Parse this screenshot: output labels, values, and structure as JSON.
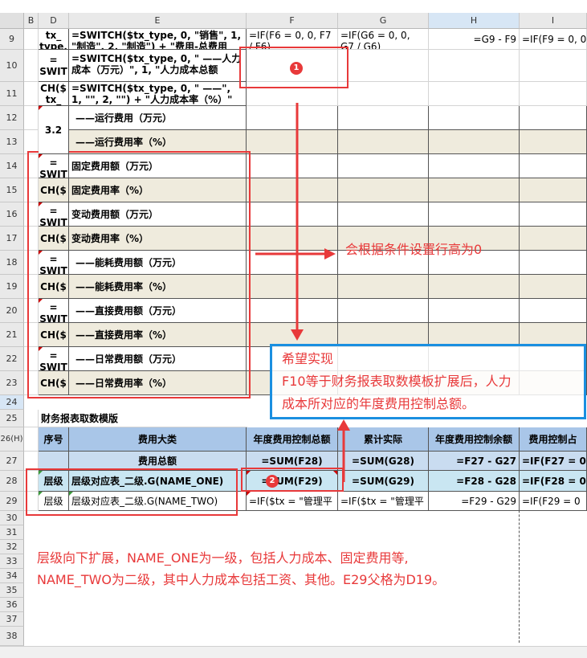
{
  "columns": [
    "B",
    "D",
    "E",
    "F",
    "G",
    "H",
    "I"
  ],
  "rows": {
    "r9": {
      "num": "9",
      "D": "tx_\ntype,",
      "E": "=SWITCH($tx_type, 0, \"销售\", 1, \"制造\", 2, \"制造\") + \"费用-总费用",
      "F": "=IF(F6 = 0, 0, F7 / F6)",
      "G": "=IF(G6 = 0, 0, G7 / G6)",
      "H": "=G9 - F9",
      "I": "=IF(F9 = 0, 0"
    },
    "r10": {
      "num": "10",
      "D": "=\nSWIT",
      "E": "=SWITCH($tx_type, 0, \" ——人力成本（万元）\", 1, \"人力成本总额"
    },
    "r11": {
      "num": "11",
      "D": "CH($\ntx_",
      "E": "=SWITCH($tx_type, 0, \" ——\", 1, \"\", 2, \"\") + \"人力成本率（%）\""
    },
    "r12": {
      "num": "12",
      "D": "3.2",
      "E": "——运行费用（万元）"
    },
    "r13": {
      "num": "13",
      "E": "——运行费用率（%）"
    },
    "r14": {
      "num": "14",
      "D": "=\nSWIT",
      "E": "固定费用额（万元）"
    },
    "r15": {
      "num": "15",
      "D": "CH($",
      "E": "固定费用率（%）"
    },
    "r16": {
      "num": "16",
      "D": "=\nSWIT",
      "E": "变动费用额（万元）"
    },
    "r17": {
      "num": "17",
      "D": "CH($",
      "E": "变动费用率（%）"
    },
    "r18": {
      "num": "18",
      "D": "=\nSWIT",
      "E": "——能耗费用额（万元）"
    },
    "r19": {
      "num": "19",
      "D": "CH($",
      "E": "——能耗费用率（%）"
    },
    "r20": {
      "num": "20",
      "D": "=\nSWIT",
      "E": "——直接费用额（万元）"
    },
    "r21": {
      "num": "21",
      "D": "CH($",
      "E": "——直接费用率（%）"
    },
    "r22": {
      "num": "22",
      "D": "=\nSWIT",
      "E": "——日常费用额（万元）"
    },
    "r23": {
      "num": "23",
      "D": "CH($",
      "E": "——日常费用率（%）"
    },
    "r24": {
      "num": "24"
    },
    "r25": {
      "num": "25",
      "D": "财务报表取数模版"
    },
    "r26": {
      "num": "26(H)",
      "D": "序号",
      "E": "费用大类",
      "F": "年度费用控制总额",
      "G": "累计实际",
      "H": "年度费用控制余额",
      "I": "费用控制占"
    },
    "r27": {
      "num": "27",
      "E": "费用总额",
      "F": "=SUM(F28)",
      "G": "=SUM(G28)",
      "H": "=F27 - G27",
      "I": "=IF(F27 = 0"
    },
    "r28": {
      "num": "28",
      "D": "层级",
      "E": "层级对应表_二级.G(NAME_ONE)",
      "F": "=SUM(F29)",
      "G": "=SUM(G29)",
      "H": "=F28 - G28",
      "I": "=IF(F28 = 0"
    },
    "r29": {
      "num": "29",
      "D": "层级",
      "E": "层级对应表_二级.G(NAME_TWO)",
      "F": "=IF($tx = \"管理平",
      "G": "=IF($tx = \"管理平",
      "H": "=F29 - G29",
      "I": "=IF(F29 = 0"
    },
    "r30": {
      "num": "30"
    },
    "r31": {
      "num": "31"
    },
    "r32": {
      "num": "32"
    },
    "r33": {
      "num": "33"
    },
    "r34": {
      "num": "34"
    },
    "r35": {
      "num": "35"
    },
    "r36": {
      "num": "36"
    },
    "r37": {
      "num": "37"
    },
    "r38": {
      "num": "38"
    }
  },
  "annotations": {
    "badge1": "1",
    "badge2": "2",
    "row_height_note": "会根据条件设置行高为0",
    "wish_line1": "希望实现",
    "wish_line2": "F10等于财务报表取数模板扩展后，人力",
    "wish_line3": "成本所对应的年度费用控制总额。",
    "expand_line1": "层级向下扩展，NAME_ONE为一级，包括人力成本、固定费用等,",
    "expand_line2": "NAME_TWO为二级，其中人力成本包括工资、其他。E29父格为D19。"
  },
  "colors": {
    "annotation": "#e8393a",
    "blue_box": "#1a8fe0",
    "header_blue": "#a9c6e8",
    "beige": "#efebdd"
  }
}
